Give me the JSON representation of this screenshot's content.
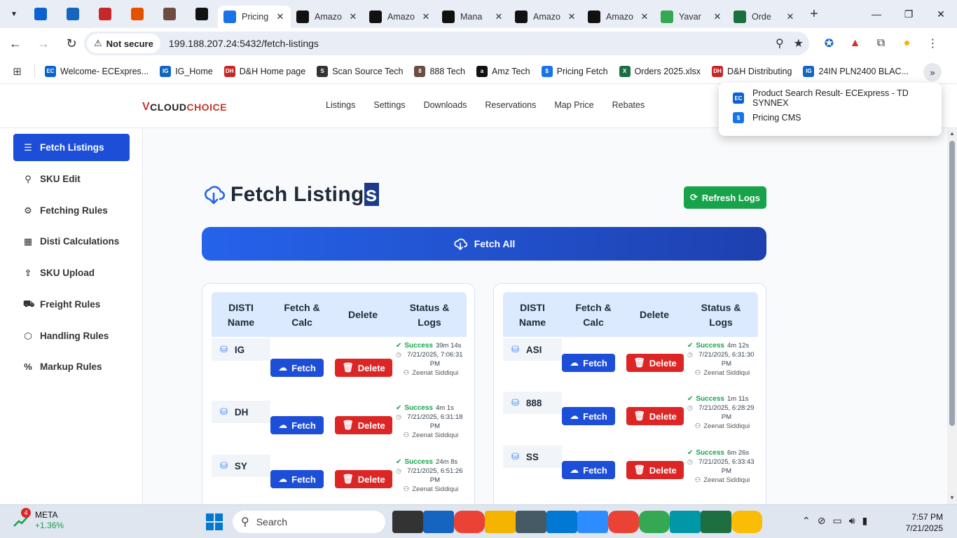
{
  "browser": {
    "tabs": [
      {
        "label": "",
        "icon": "ecexpress-icon",
        "color": "#0b63ce",
        "pinned": true
      },
      {
        "label": "",
        "icon": "ig-icon",
        "color": "#1565c0",
        "pinned": true
      },
      {
        "label": "",
        "icon": "dh-icon",
        "color": "#c62828",
        "pinned": true
      },
      {
        "label": "",
        "icon": "scansource-icon",
        "color": "#e65100",
        "pinned": true
      },
      {
        "label": "",
        "icon": "888-icon",
        "color": "#6d4c41",
        "pinned": true
      },
      {
        "label": "",
        "icon": "amazon-icon",
        "color": "#111111",
        "pinned": true
      },
      {
        "label": "Pricing",
        "icon": "pricing-icon",
        "color": "#1a73e8"
      },
      {
        "label": "Amazo",
        "icon": "amazon-icon",
        "color": "#111111"
      },
      {
        "label": "Amazo",
        "icon": "amazon-icon",
        "color": "#111111"
      },
      {
        "label": "Mana",
        "icon": "amazon-icon",
        "color": "#111111"
      },
      {
        "label": "Amazo",
        "icon": "amazon-icon",
        "color": "#111111"
      },
      {
        "label": "Amazo",
        "icon": "amazon-icon",
        "color": "#111111"
      },
      {
        "label": "Yavar",
        "icon": "maps-icon",
        "color": "#34a853"
      },
      {
        "label": "Orde",
        "icon": "excel-icon",
        "color": "#1d6f42"
      }
    ],
    "security_label": "Not secure",
    "url": "199.188.207.24:5432/fetch-listings",
    "bookmarks": [
      {
        "label": "Welcome- ECExpres...",
        "color": "#0b63ce",
        "abbr": "EC"
      },
      {
        "label": "IG_Home",
        "color": "#1565c0",
        "abbr": "IG"
      },
      {
        "label": "D&H Home page",
        "color": "#c62828",
        "abbr": "DH"
      },
      {
        "label": "Scan Source Tech",
        "color": "#333333",
        "abbr": "S"
      },
      {
        "label": "888 Tech",
        "color": "#6d4c41",
        "abbr": "8"
      },
      {
        "label": "Amz Tech",
        "color": "#111111",
        "abbr": "a"
      },
      {
        "label": "Pricing Fetch",
        "color": "#1a73e8",
        "abbr": "$"
      },
      {
        "label": "Orders 2025.xlsx",
        "color": "#1d6f42",
        "abbr": "X"
      },
      {
        "label": "D&H Distributing",
        "color": "#c62828",
        "abbr": "DH"
      },
      {
        "label": "24IN PLN2400 BLAC...",
        "color": "#1565c0",
        "abbr": "IG"
      }
    ],
    "overflow_menu": [
      {
        "label": "Product Search Result- ECExpress - TD SYNNEX",
        "color": "#0b63ce",
        "abbr": "EC"
      },
      {
        "label": "Pricing CMS",
        "color": "#1a73e8",
        "abbr": "$"
      }
    ]
  },
  "app": {
    "logo": {
      "v": "V",
      "cloud": "CLOUD",
      "choice": "CHOICE"
    },
    "nav": [
      "Listings",
      "Settings",
      "Downloads",
      "Reservations",
      "Map Price",
      "Rebates"
    ],
    "sidebar": [
      {
        "label": "Fetch Listings",
        "icon": "list-icon",
        "glyph": "☰",
        "active": true
      },
      {
        "label": "SKU Edit",
        "icon": "search-icon",
        "glyph": "⚲"
      },
      {
        "label": "Fetching Rules",
        "icon": "gear-icon",
        "glyph": "⚙"
      },
      {
        "label": "Disti Calculations",
        "icon": "calculator-icon",
        "glyph": "▦"
      },
      {
        "label": "SKU Upload",
        "icon": "upload-icon",
        "glyph": "⇪"
      },
      {
        "label": "Freight Rules",
        "icon": "truck-icon",
        "glyph": "⛟"
      },
      {
        "label": "Handling Rules",
        "icon": "box-icon",
        "glyph": "⬡"
      },
      {
        "label": "Markup Rules",
        "icon": "percent-icon",
        "glyph": "%"
      }
    ],
    "page_title_main": "Fetch Listing",
    "page_title_selected": "s",
    "refresh_label": "Refresh Logs",
    "fetch_all_label": "Fetch All",
    "table_headers": {
      "name": "DISTI Name",
      "fetch": "Fetch & Calc",
      "delete": "Delete",
      "status": "Status & Logs"
    },
    "fetch_label": "Fetch",
    "delete_label": "Delete",
    "left_table": [
      {
        "name": "IG",
        "status": "Success",
        "duration": "39m 14s",
        "timestamp": "7/21/2025, 7:06:31 PM",
        "user": "Zeenat Siddiqui"
      },
      {
        "name": "DH",
        "status": "Success",
        "duration": "4m 1s",
        "timestamp": "7/21/2025, 6:31:18 PM",
        "user": "Zeenat Siddiqui"
      },
      {
        "name": "SY",
        "status": "Success",
        "duration": "24m 8s",
        "timestamp": "7/21/2025, 6:51:26 PM",
        "user": "Zeenat Siddiqui"
      }
    ],
    "right_table": [
      {
        "name": "ASI",
        "status": "Success",
        "duration": "4m 12s",
        "timestamp": "7/21/2025, 6:31:30 PM",
        "user": "Zeenat Siddiqui"
      },
      {
        "name": "888",
        "status": "Success",
        "duration": "1m 11s",
        "timestamp": "7/21/2025, 6:28:29 PM",
        "user": "Zeenat Siddiqui"
      },
      {
        "name": "SS",
        "status": "Success",
        "duration": "6m 26s",
        "timestamp": "7/21/2025, 6:33:43 PM",
        "user": "Zeenat Siddiqui"
      }
    ]
  },
  "taskbar": {
    "stock_badge": "4",
    "stock_ticker": "META",
    "stock_change": "+1.36%",
    "search_placeholder": "Search",
    "apps": [
      {
        "icon": "task-view-icon",
        "color": "#333333"
      },
      {
        "icon": "store-icon",
        "color": "#1565c0"
      },
      {
        "icon": "chrome-icon",
        "color": "#ea4335"
      },
      {
        "icon": "file-explorer-icon",
        "color": "#f4b400"
      },
      {
        "icon": "calculator-icon",
        "color": "#455a64"
      },
      {
        "icon": "outlook-icon",
        "color": "#0078d4"
      },
      {
        "icon": "zoom-icon",
        "color": "#2d8cff"
      },
      {
        "icon": "chrome-icon",
        "color": "#ea4335"
      },
      {
        "icon": "chrome-icon",
        "color": "#34a853"
      },
      {
        "icon": "app-icon",
        "color": "#0097a7"
      },
      {
        "icon": "excel-icon",
        "color": "#1d6f42"
      },
      {
        "icon": "chrome-icon",
        "color": "#fbbc05"
      }
    ],
    "time": "7:57 PM",
    "date": "7/21/2025"
  },
  "colors": {
    "primary": "#1d4ed8",
    "success": "#16a34a",
    "danger": "#dc2626",
    "header_bg": "#dbeafe"
  }
}
